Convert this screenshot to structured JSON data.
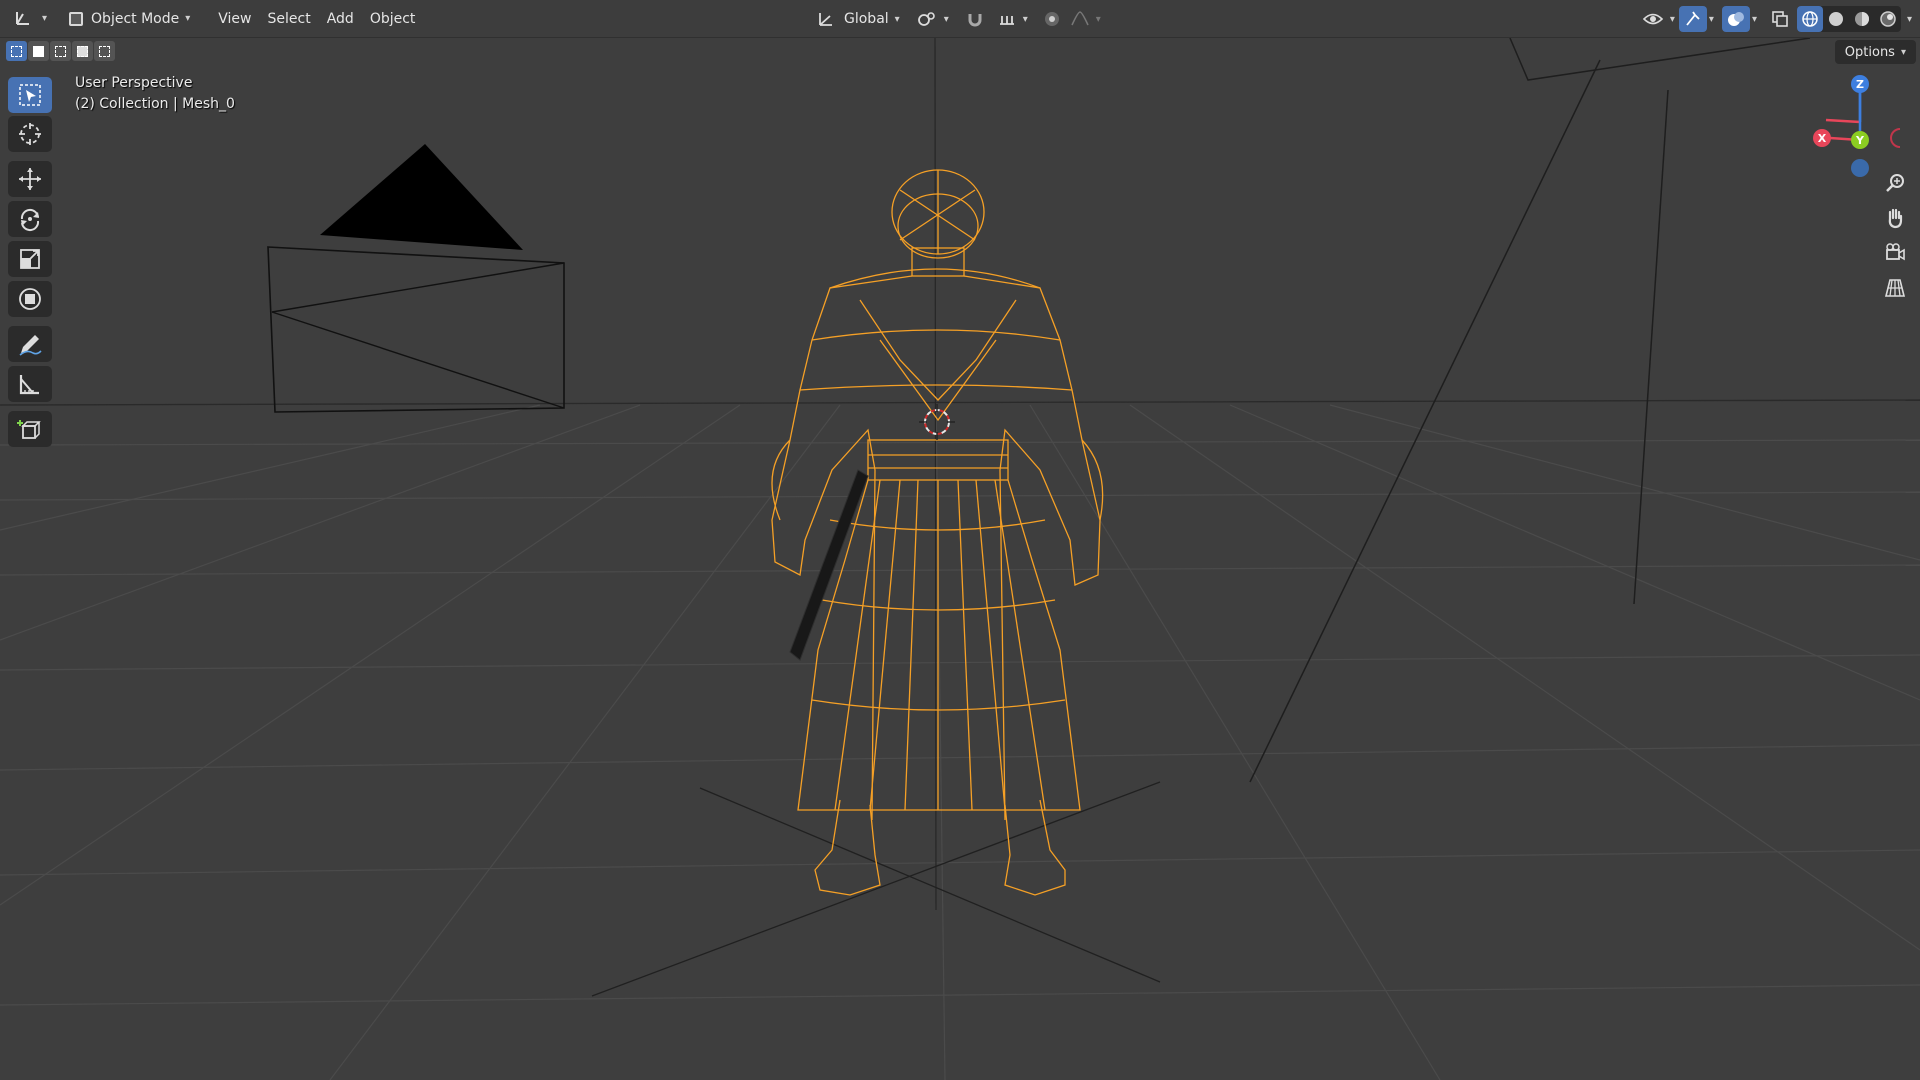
{
  "header": {
    "mode": "Object Mode",
    "menus": [
      "View",
      "Select",
      "Add",
      "Object"
    ],
    "orientation": "Global"
  },
  "viewport": {
    "perspective": "User Perspective",
    "collection": "(2) Collection | Mesh_0",
    "options_label": "Options"
  },
  "gizmo": {
    "axes": [
      "Z",
      "Y",
      "X"
    ],
    "colors": {
      "x": "#e8465a",
      "y": "#8ccd22",
      "z": "#3d7fe0"
    }
  },
  "toolbar": {
    "tools": [
      "select-box",
      "cursor",
      "move",
      "rotate",
      "scale",
      "transform",
      "annotate",
      "measure",
      "add-cube"
    ],
    "active": "select-box"
  },
  "nav": [
    "zoom",
    "pan",
    "camera",
    "perspective-toggle"
  ],
  "colors": {
    "selection": "#f5a026",
    "header_bg": "#3d3d3d",
    "viewport_bg": "#3e3e3e",
    "active_tool": "#4772b3"
  }
}
